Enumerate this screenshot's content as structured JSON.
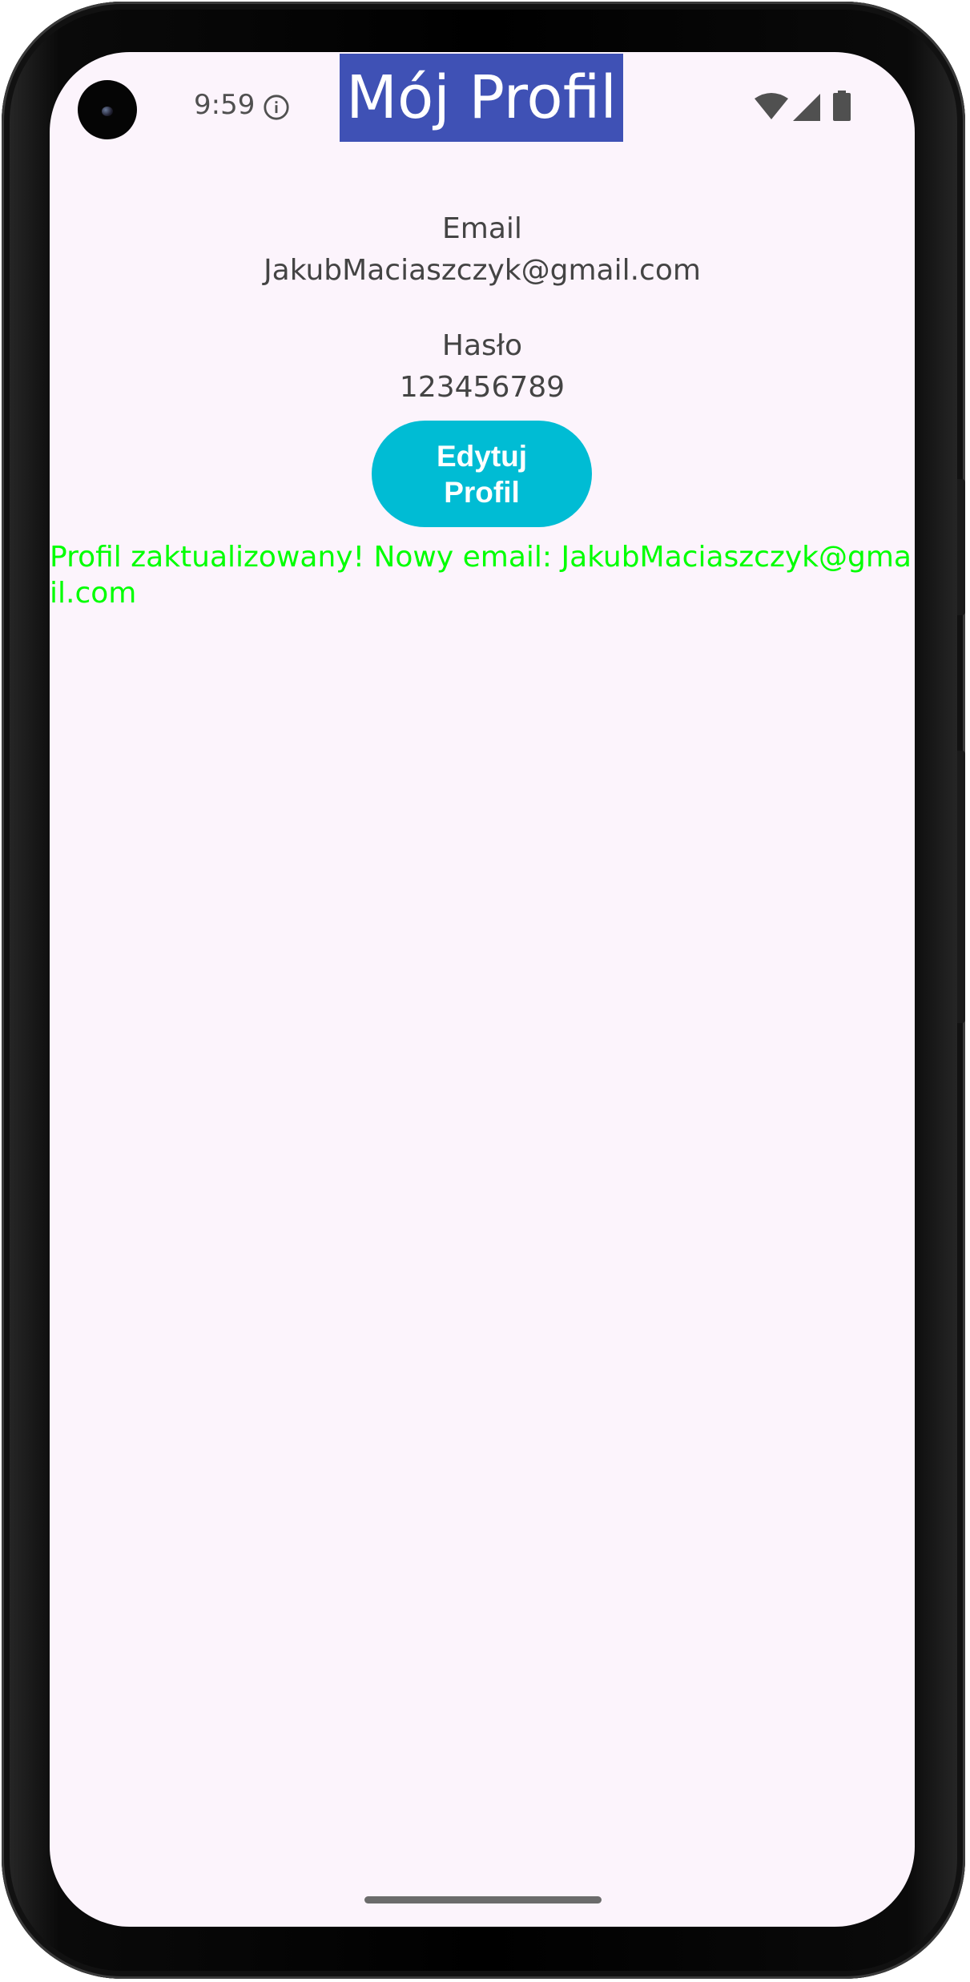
{
  "status_bar": {
    "time": "9:59",
    "icons": [
      "info-icon",
      "wifi-icon",
      "cellular-signal-icon",
      "battery-icon"
    ]
  },
  "app_bar": {
    "title": "Mój Profil",
    "background_color": "#3f51b5"
  },
  "profile": {
    "email_label": "Email",
    "email_value": "JakubMaciaszczyk@gmail.com",
    "password_label": "Hasło",
    "password_value": "123456789"
  },
  "edit_button": {
    "label": "Edytuj Profil",
    "color": "#00bcd4"
  },
  "message": {
    "text": "Profil zaktualizowany! Nowy email: JakubMaciaszczyk@gmail.com",
    "color": "#00ff00"
  }
}
